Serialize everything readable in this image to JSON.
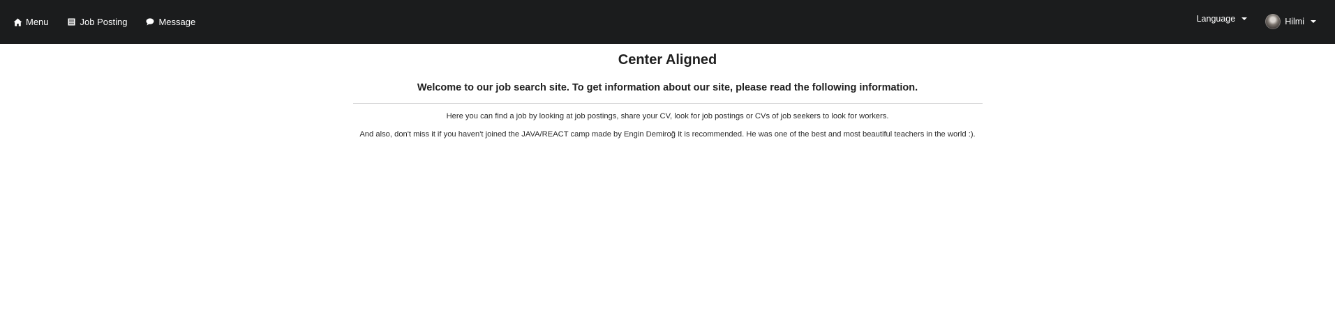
{
  "nav": {
    "items": [
      {
        "label": "Menu",
        "icon": "home-icon"
      },
      {
        "label": "Job Posting",
        "icon": "list-icon"
      },
      {
        "label": "Message",
        "icon": "comment-icon"
      }
    ],
    "language_label": "Language",
    "user": {
      "name": "Hilmi",
      "avatar": "avatar-icon"
    }
  },
  "content": {
    "title": "Center Aligned",
    "subtitle": "Welcome to our job search site. To get information about our site, please read the following information.",
    "paragraphs": [
      "Here you can find a job by looking at job postings, share your CV, look for job postings or CVs of job seekers to look for workers.",
      "And also, don't miss it if you haven't joined the JAVA/REACT camp made by Engin Demiroğ It is recommended. He was one of the best and most beautiful teachers in the world :)."
    ]
  },
  "colors": {
    "navbar_bg": "#1b1c1d",
    "nav_text": "#ffffff",
    "body_text": "#1f1f1f",
    "divider": "#d4d4d5"
  }
}
